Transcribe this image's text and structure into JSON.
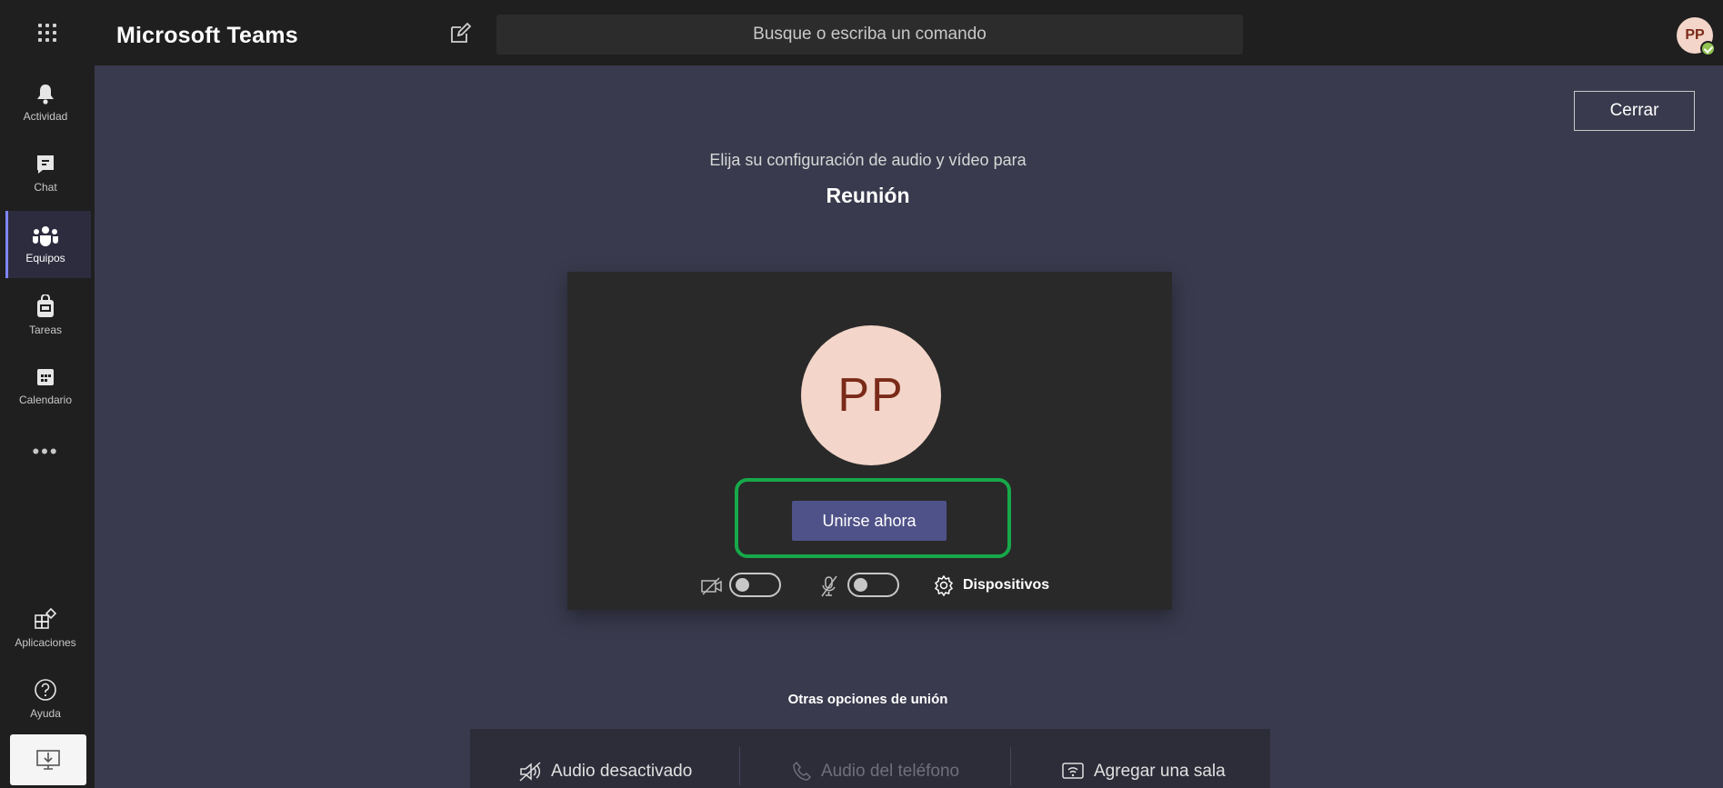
{
  "app": {
    "title": "Microsoft Teams",
    "search_placeholder": "Busque o escriba un comando",
    "user_initials": "PP"
  },
  "rail": {
    "items": [
      {
        "label": "Actividad",
        "icon": "bell-icon"
      },
      {
        "label": "Chat",
        "icon": "chat-icon"
      },
      {
        "label": "Equipos",
        "icon": "teams-icon",
        "active": true
      },
      {
        "label": "Tareas",
        "icon": "tasks-icon"
      },
      {
        "label": "Calendario",
        "icon": "calendar-icon"
      }
    ],
    "more": "•••",
    "apps_label": "Aplicaciones",
    "help_label": "Ayuda"
  },
  "prejoin": {
    "close_label": "Cerrar",
    "prompt": "Elija su configuración de audio y vídeo para",
    "meeting_name": "Reunión",
    "avatar_initials": "PP",
    "join_label": "Unirse ahora",
    "camera_on": false,
    "mic_on": false,
    "devices_label": "Dispositivos"
  },
  "other_options": {
    "title": "Otras opciones de unión",
    "audio_off": "Audio desactivado",
    "phone_audio": "Audio del teléfono",
    "add_room": "Agregar una sala"
  },
  "colors": {
    "accent": "#4f5288",
    "highlight": "#17a84a",
    "background": "#393a4d",
    "rail": "#1f1f1f"
  }
}
